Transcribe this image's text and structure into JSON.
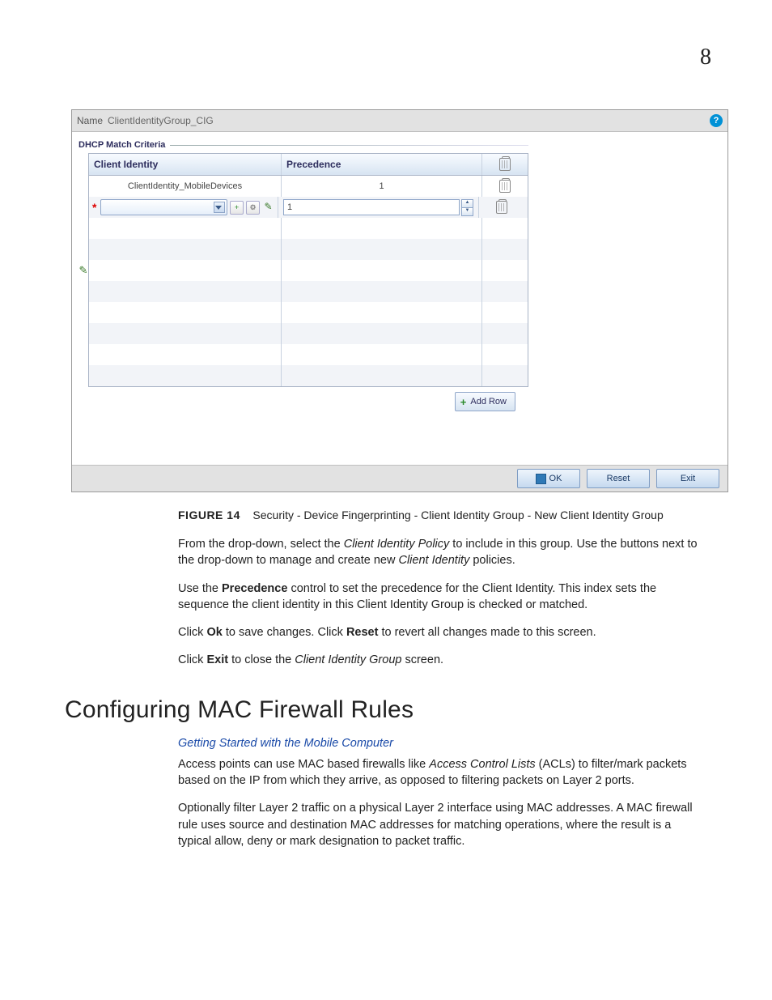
{
  "page_number": "8",
  "panel": {
    "name_label": "Name",
    "name_value": "ClientIdentityGroup_CIG",
    "help": "?",
    "fieldset_title": "DHCP Match Criteria",
    "columns": {
      "c1": "Client Identity",
      "c2": "Precedence"
    },
    "row1": {
      "ci": "ClientIdentity_MobileDevices",
      "pr": "1"
    },
    "spinner_value": "1",
    "add_row": "Add Row",
    "ok": "OK",
    "reset": "Reset",
    "exit": "Exit"
  },
  "figure": {
    "lead": "FIGURE 14",
    "text": "Security - Device Fingerprinting - Client Identity Group - New Client Identity Group"
  },
  "p1a": "From the drop-down, select the ",
  "p1i": "Client Identity Policy",
  "p1b": " to include in this group. Use the buttons next to the drop-down to manage and create new ",
  "p1i2": "Client Identity",
  "p1c": " policies.",
  "p2a": "Use the ",
  "p2b1": "Precedence",
  "p2b": " control to set the precedence for the Client Identity. This index sets the sequence the client identity in this Client Identity Group is checked or matched.",
  "p3a": "Click ",
  "p3b1": "Ok",
  "p3b": " to save changes. Click ",
  "p3b2": "Reset",
  "p3c": " to revert all changes made to this screen.",
  "p4a": "Click ",
  "p4b1": "Exit",
  "p4b": " to close the ",
  "p4i": "Client Identity Group",
  "p4c": " screen.",
  "h2": "Configuring MAC Firewall Rules",
  "link": "Getting Started with the Mobile Computer",
  "p5a": "Access points can use MAC based firewalls like ",
  "p5i": "Access Control Lists",
  "p5b": " (ACLs) to filter/mark packets based on the IP from which they arrive, as opposed to filtering packets on Layer 2 ports.",
  "p6": "Optionally filter Layer 2 traffic on a physical Layer 2 interface using MAC addresses. A MAC firewall rule uses source and destination MAC addresses for matching operations, where the result is a typical allow, deny or mark designation to packet traffic."
}
